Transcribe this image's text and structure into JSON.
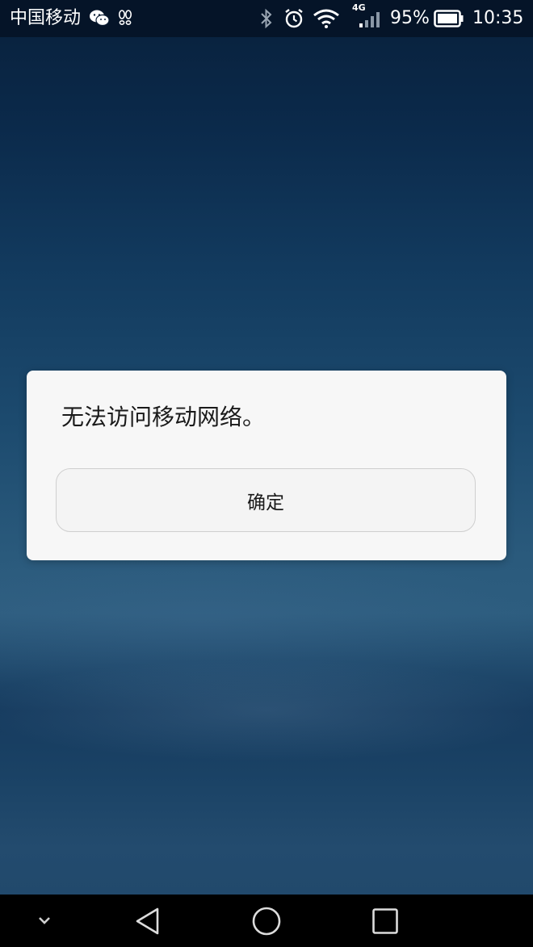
{
  "status_bar": {
    "carrier": "中国移动",
    "network_type": "4G",
    "battery_percent": "95%",
    "time": "10:35",
    "icons": [
      "wechat-icon",
      "footprint-icon",
      "bluetooth-icon",
      "alarm-icon",
      "wifi-icon",
      "signal-icon",
      "battery-icon"
    ]
  },
  "dialog": {
    "message": "无法访问移动网络。",
    "confirm_label": "确定"
  },
  "nav_bar": {
    "icons": [
      "collapse-icon",
      "back-icon",
      "home-icon",
      "recents-icon"
    ]
  },
  "colors": {
    "dialog_background": "#f7f7f7",
    "status_bar_background": "#041226",
    "nav_bar_background": "#000000"
  }
}
